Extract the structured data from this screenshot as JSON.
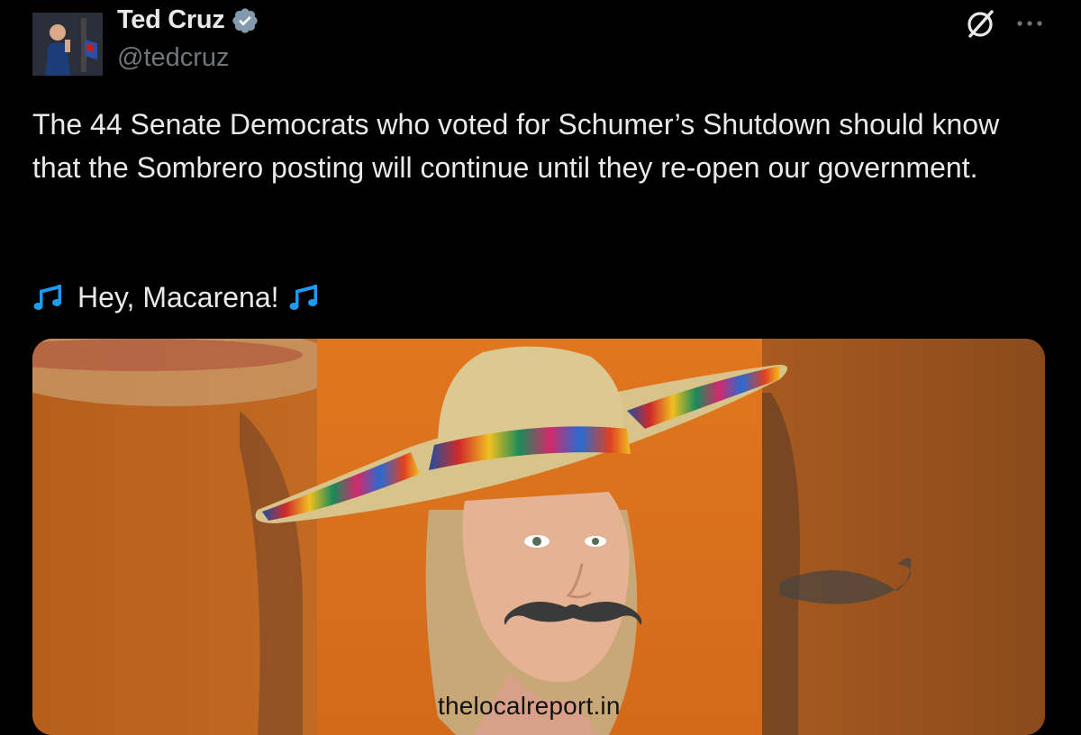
{
  "tweet": {
    "author": {
      "display_name": "Ted Cruz",
      "handle": "@tedcruz",
      "verified": true,
      "avatar_icon": "avatar-photo"
    },
    "body": "The 44 Senate Democrats who voted for Schumer’s Shutdown should know that the Sombrero posting will continue until they re-open our government.",
    "line2": "Hey, Macarena!",
    "media_icon": "tweet-image",
    "actions": {
      "grok_icon": "grok-icon",
      "more_icon": "more-icon"
    }
  },
  "watermark": "thelocalreport.in",
  "colors": {
    "background": "#000000",
    "text": "#e7e9ea",
    "secondary_text": "#71767b",
    "verified": "#829aab",
    "music_note": "#1d9bf0",
    "media_orange": "#c8681f"
  }
}
